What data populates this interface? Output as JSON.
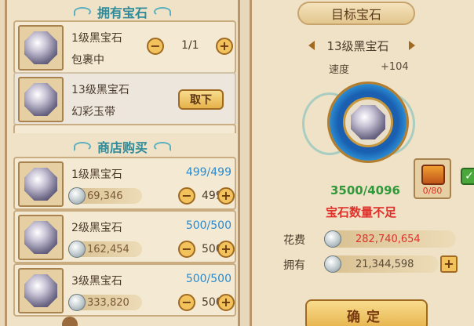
{
  "owned": {
    "title": "拥有宝石",
    "items": [
      {
        "name": "1级黑宝石",
        "location": "包裹中",
        "count": "1/1",
        "minus": "−",
        "plus": "+"
      },
      {
        "name": "13级黑宝石",
        "location": "幻彩玉带",
        "action": "取下"
      }
    ]
  },
  "shop": {
    "title": "商店购买",
    "items": [
      {
        "name": "1级黑宝石",
        "stock": "499/499",
        "price": "69,346",
        "qty": "499",
        "minus": "−",
        "plus": "+"
      },
      {
        "name": "2级黑宝石",
        "stock": "500/500",
        "price": "162,454",
        "qty": "500",
        "minus": "−",
        "plus": "+"
      },
      {
        "name": "3级黑宝石",
        "stock": "500/500",
        "price": "333,820",
        "qty": "500",
        "minus": "−",
        "plus": "+"
      }
    ]
  },
  "target": {
    "title": "目标宝石",
    "name": "13级黑宝石",
    "stat_label": "速度",
    "stat_value": "+104",
    "progress": "3500/4096",
    "warning": "宝石数量不足",
    "chest_count": "0/80",
    "check": "✓"
  },
  "cost": {
    "fee_label": "花费",
    "fee_value": "282,740,654",
    "own_label": "拥有",
    "own_value": "21,344,598",
    "plus": "+"
  },
  "confirm": {
    "label": "确定"
  },
  "colors": {
    "accent_teal": "#2f8a9a",
    "stock_blue": "#2a8ad0",
    "progress_green": "#2f9a3a",
    "warning_red": "#e0302a"
  }
}
